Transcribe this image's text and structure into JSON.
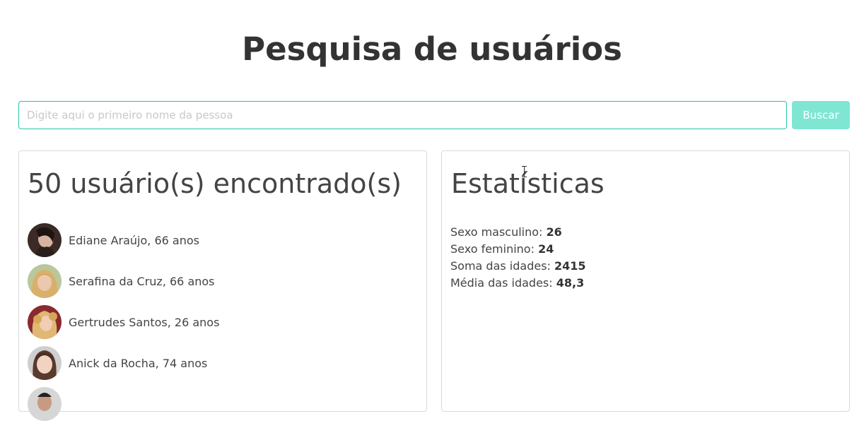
{
  "header": {
    "title": "Pesquisa de usuários"
  },
  "search": {
    "placeholder": "Digite aqui o primeiro nome da pessoa",
    "value": "",
    "button_label": "Buscar",
    "accent_color": "#26c6a6",
    "button_color": "#7fe6d4"
  },
  "users_panel": {
    "heading": "50 usuário(s) encontrado(s)",
    "items": [
      {
        "label": "Ediane Araújo, 66 anos",
        "avatar": "avatar-photo"
      },
      {
        "label": "Serafina da Cruz, 66 anos",
        "avatar": "avatar-photo"
      },
      {
        "label": "Gertrudes Santos, 26 anos",
        "avatar": "avatar-photo"
      },
      {
        "label": "Anick da Rocha, 74 anos",
        "avatar": "avatar-photo"
      }
    ]
  },
  "stats_panel": {
    "heading": "Estatísticas",
    "rows": [
      {
        "label": "Sexo masculino: ",
        "value": "26"
      },
      {
        "label": "Sexo feminino: ",
        "value": "24"
      },
      {
        "label": "Soma das idades: ",
        "value": "2415"
      },
      {
        "label": "Média das idades: ",
        "value": "48,3"
      }
    ]
  }
}
